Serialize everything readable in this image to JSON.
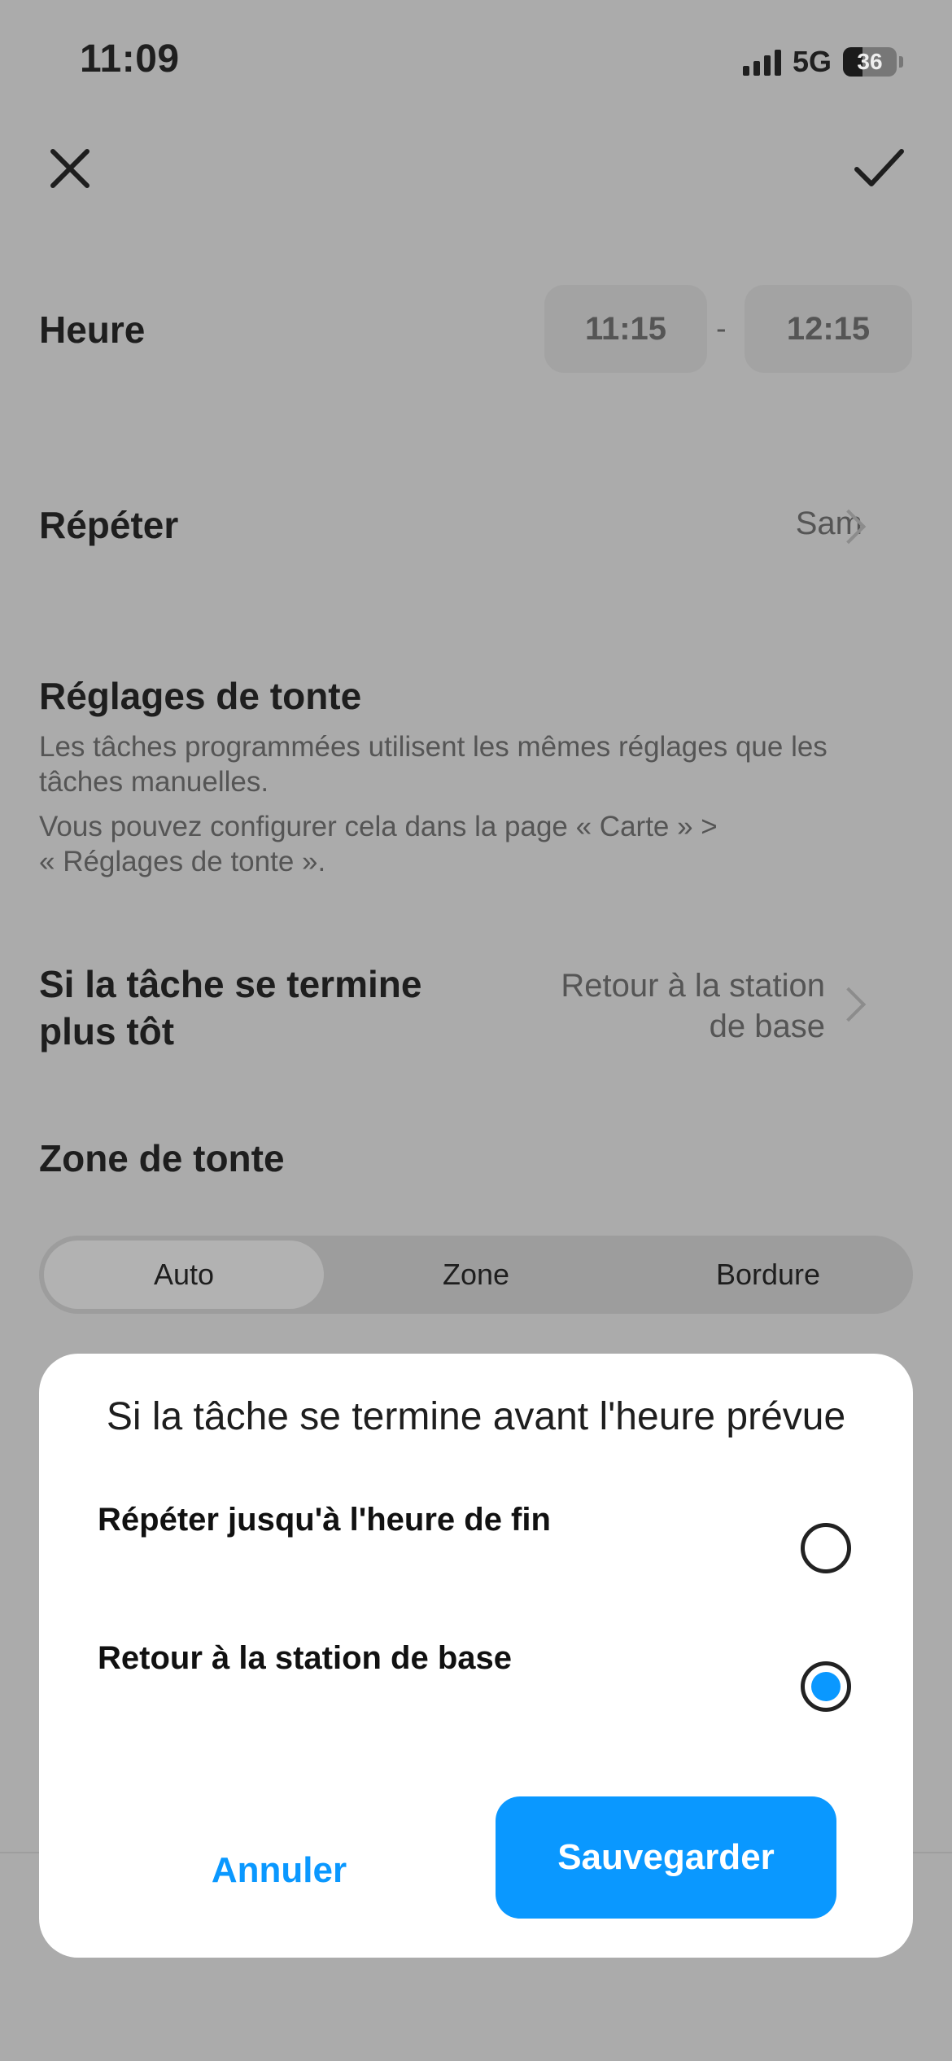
{
  "status_bar": {
    "time": "11:09",
    "network": "5G",
    "battery": "36"
  },
  "header": {
    "close_icon": "close-icon",
    "confirm_icon": "checkmark-icon"
  },
  "time_row": {
    "label": "Heure",
    "start": "11:15",
    "separator": "-",
    "end": "12:15"
  },
  "repeat_row": {
    "label": "Répéter",
    "value": "Sam"
  },
  "mowing_settings": {
    "title": "Réglages de tonte",
    "description_1_line_1": "Les tâches programmées utilisent les mêmes réglages que les",
    "description_1_line_2": "tâches manuelles.",
    "description_2_line_1": "Vous pouvez configurer cela dans la page « Carte » >",
    "description_2_line_2": "« Réglages de tonte »."
  },
  "early_finish_row": {
    "label_line_1": "Si la tâche se termine",
    "label_line_2": "plus tôt",
    "value_line_1": "Retour à la station",
    "value_line_2": "de base"
  },
  "mowing_zone": {
    "title": "Zone de tonte",
    "options": [
      "Auto",
      "Zone",
      "Bordure"
    ],
    "selected": "Auto"
  },
  "dialog": {
    "title": "Si la tâche se termine avant l'heure prévue",
    "options": [
      {
        "label": "Répéter jusqu'à l'heure de fin",
        "selected": false
      },
      {
        "label": "Retour à la station de base",
        "selected": true
      }
    ],
    "cancel_label": "Annuler",
    "save_label": "Sauvegarder"
  },
  "colors": {
    "accent": "#0a98ff",
    "overlay": "#ababab",
    "sheet": "#ffffff"
  }
}
